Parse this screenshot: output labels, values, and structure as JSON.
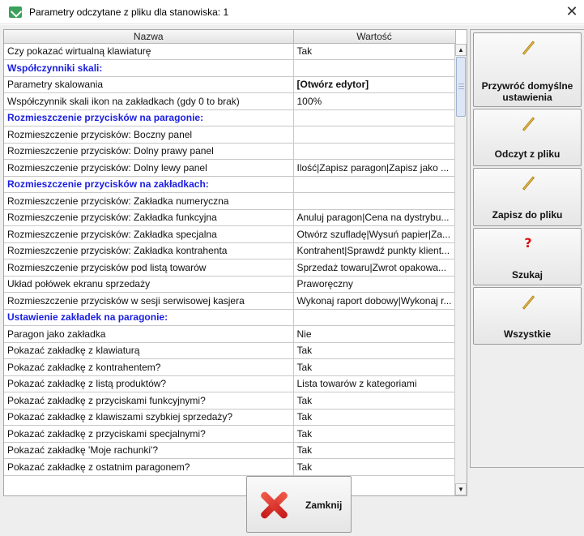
{
  "window": {
    "title": "Parametry odczytane z pliku dla stanowiska: 1",
    "close_glyph": "✕"
  },
  "table": {
    "columns": [
      "Nazwa",
      "Wartość"
    ],
    "rows": [
      {
        "name": "Czy pokazać wirtualną klawiaturę",
        "value": "Tak",
        "section": false
      },
      {
        "name": "Współczynniki skali:",
        "value": "",
        "section": true
      },
      {
        "name": "Parametry skalowania",
        "value": "[Otwórz edytor]",
        "section": false,
        "value_bold": true
      },
      {
        "name": "Współczynnik skali ikon na zakładkach (gdy 0 to brak)",
        "value": "100%",
        "section": false
      },
      {
        "name": "Rozmieszczenie przycisków na paragonie:",
        "value": "",
        "section": true
      },
      {
        "name": "Rozmieszczenie przycisków: Boczny panel",
        "value": "",
        "section": false
      },
      {
        "name": "Rozmieszczenie przycisków: Dolny prawy panel",
        "value": "",
        "section": false
      },
      {
        "name": "Rozmieszczenie przycisków: Dolny lewy panel",
        "value": "Ilość|Zapisz paragon|Zapisz jako ...",
        "section": false
      },
      {
        "name": "Rozmieszczenie przycisków na zakładkach:",
        "value": "",
        "section": true
      },
      {
        "name": "Rozmieszczenie przycisków: Zakładka numeryczna",
        "value": "",
        "section": false
      },
      {
        "name": "Rozmieszczenie przycisków: Zakładka funkcyjna",
        "value": "Anuluj paragon|Cena na dystrybu...",
        "section": false
      },
      {
        "name": "Rozmieszczenie przycisków: Zakładka specjalna",
        "value": "Otwórz szufladę|Wysuń papier|Za...",
        "section": false
      },
      {
        "name": "Rozmieszczenie przycisków: Zakładka kontrahenta",
        "value": "Kontrahent|Sprawdź punkty klient...",
        "section": false
      },
      {
        "name": "Rozmieszczenie przycisków pod listą towarów",
        "value": "Sprzedaż towaru|Zwrot opakowa...",
        "section": false
      },
      {
        "name": "Układ połówek ekranu sprzedaży",
        "value": "Praworęczny",
        "section": false
      },
      {
        "name": "Rozmieszczenie przycisków w sesji serwisowej kasjera",
        "value": "Wykonaj raport dobowy|Wykonaj r...",
        "section": false
      },
      {
        "name": "Ustawienie zakładek na paragonie:",
        "value": "",
        "section": true
      },
      {
        "name": "Paragon jako zakładka",
        "value": "Nie",
        "section": false
      },
      {
        "name": "Pokazać zakładkę z klawiaturą",
        "value": "Tak",
        "section": false
      },
      {
        "name": "Pokazać zakładkę z kontrahentem?",
        "value": "Tak",
        "section": false
      },
      {
        "name": "Pokazać zakładkę z listą produktów?",
        "value": "Lista towarów z kategoriami",
        "section": false
      },
      {
        "name": "Pokazać zakładkę z przyciskami funkcyjnymi?",
        "value": "Tak",
        "section": false
      },
      {
        "name": "Pokazać zakładkę z klawiszami szybkiej sprzedaży?",
        "value": "Tak",
        "section": false
      },
      {
        "name": "Pokazać zakładkę z przyciskami specjalnymi?",
        "value": "Tak",
        "section": false
      },
      {
        "name": "Pokazać zakładkę 'Moje rachunki'?",
        "value": "Tak",
        "section": false
      },
      {
        "name": "Pokazać zakładkę z ostatnim paragonem?",
        "value": "Tak",
        "section": false
      }
    ]
  },
  "side_buttons": [
    {
      "label": "Przywróć domyślne ustawienia",
      "icon": "pencil-icon"
    },
    {
      "label": "Odczyt z pliku",
      "icon": "pencil-icon"
    },
    {
      "label": "Zapisz do pliku",
      "icon": "pencil-icon"
    },
    {
      "label": "Szukaj",
      "icon": "question-icon",
      "glyph": "?"
    },
    {
      "label": "Wszystkie",
      "icon": "pencil-icon"
    }
  ],
  "footer": {
    "close_label": "Zamknij"
  },
  "scrollbar": {
    "up_glyph": "▲",
    "down_glyph": "▼"
  },
  "colors": {
    "section_text": "#1a1ee0",
    "close_icon": "#d81010",
    "app_icon": "#3aa15a"
  }
}
